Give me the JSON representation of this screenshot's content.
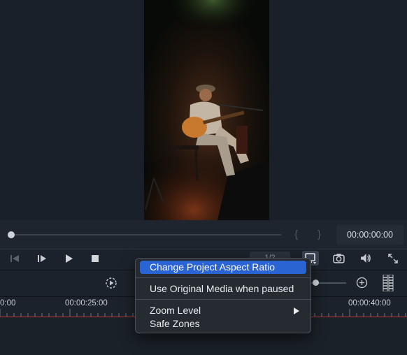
{
  "player": {
    "timecode": "00:00:00:00",
    "in_marker": "{",
    "out_marker": "}",
    "fraction": "1/2"
  },
  "timeline": {
    "labels": [
      "0:00",
      "00:00:25:00",
      "00:00:40:00"
    ]
  },
  "context_menu": {
    "items": [
      {
        "label": "Change Project Aspect Ratio",
        "highlighted": true
      },
      {
        "label": "Use Original Media when paused"
      },
      {
        "label": "Zoom Level",
        "submenu": true
      },
      {
        "label": "Safe Zones"
      }
    ]
  },
  "colors": {
    "highlight": "#2a63d2",
    "playhead_line": "#c63232",
    "background": "#1c222b"
  }
}
